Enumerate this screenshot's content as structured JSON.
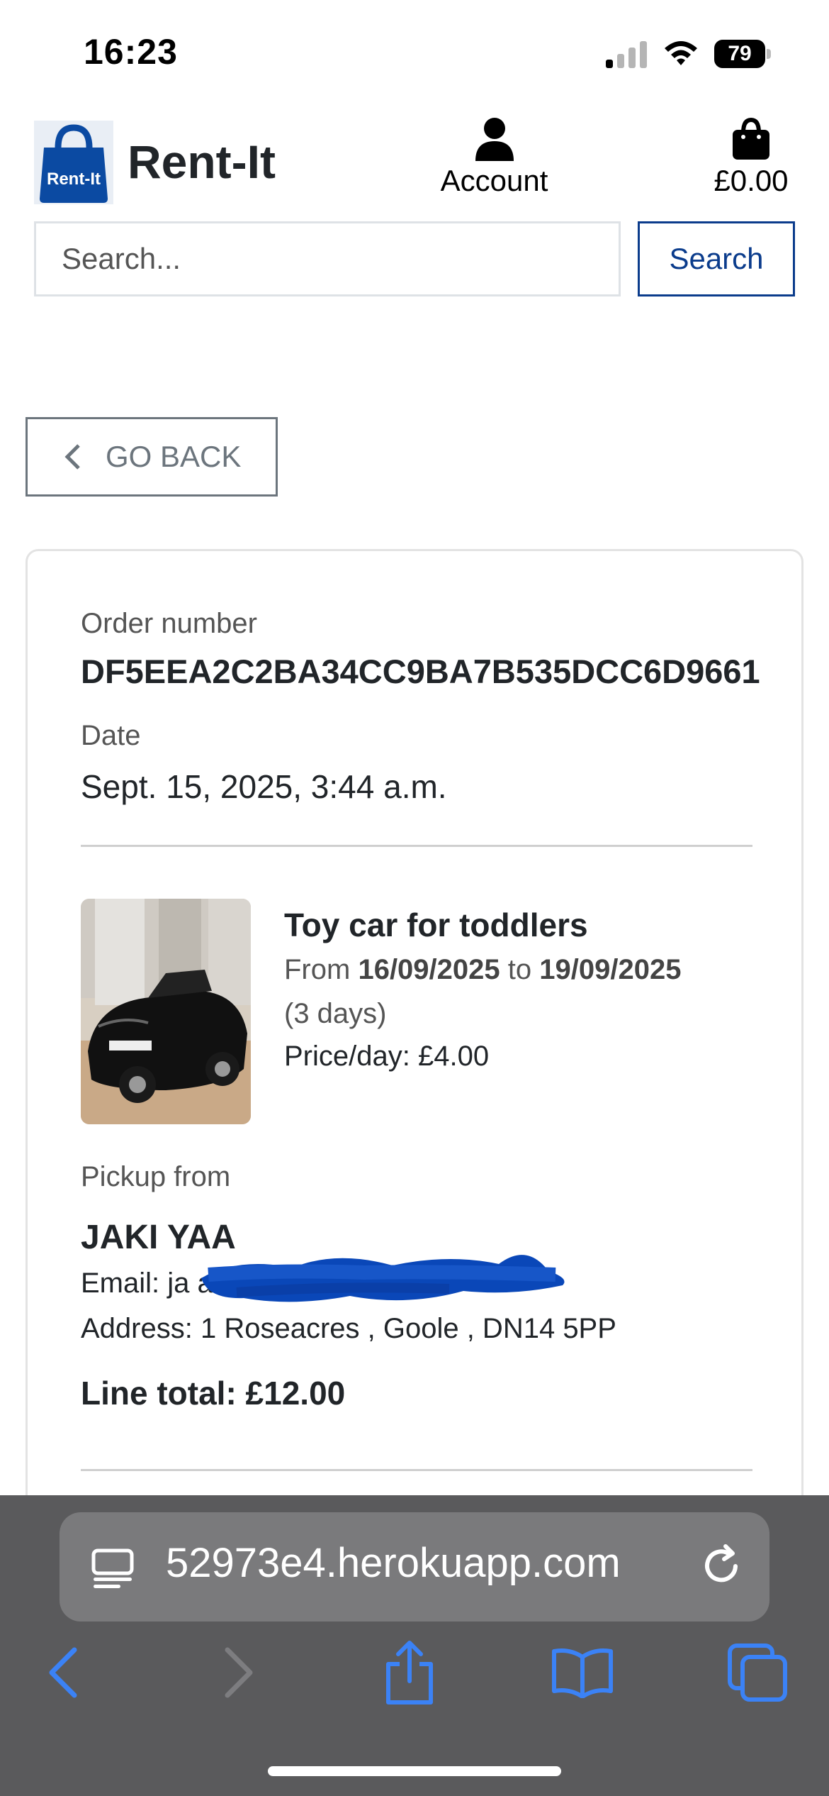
{
  "status_bar": {
    "time": "16:23",
    "battery": "79",
    "icons": [
      "cellular-signal-icon",
      "wifi-icon",
      "battery-icon"
    ]
  },
  "header": {
    "logo_text": "Rent-It",
    "brand": "Rent-It",
    "account_label": "Account",
    "cart_total": "£0.00"
  },
  "search": {
    "placeholder": "Search...",
    "value": "",
    "button_label": "Search"
  },
  "go_back": {
    "label": "GO BACK"
  },
  "order": {
    "number_label": "Order number",
    "number": "DF5EEA2C2BA34CC9BA7B535DCC6D9661",
    "date_label": "Date",
    "date": "Sept. 15, 2025, 3:44 a.m.",
    "item": {
      "title": "Toy car for toddlers",
      "from_word": "From",
      "from_date": "16/09/2025",
      "to_word": "to",
      "to_date": "19/09/2025",
      "duration": "(3 days)",
      "price_per_day": "Price/day: £4.00"
    },
    "pickup": {
      "label": "Pickup from",
      "owner": "JAKI YAA",
      "email": "Email: ja            ail.com",
      "address": "Address: 1 Roseacres , Goole , DN14 5PP"
    },
    "line_total": "Line total: £12.00"
  },
  "browser": {
    "url": "52973e4.herokuapp.com",
    "toolbar_icons": [
      "back-icon",
      "forward-icon",
      "share-icon",
      "bookmarks-icon",
      "tabs-icon"
    ]
  },
  "colors": {
    "brand_blue": "#0b3c8c",
    "scribble_blue": "#0a47b8",
    "safari_bar": "#5a5a5c",
    "safari_accent": "#3b82f6"
  }
}
